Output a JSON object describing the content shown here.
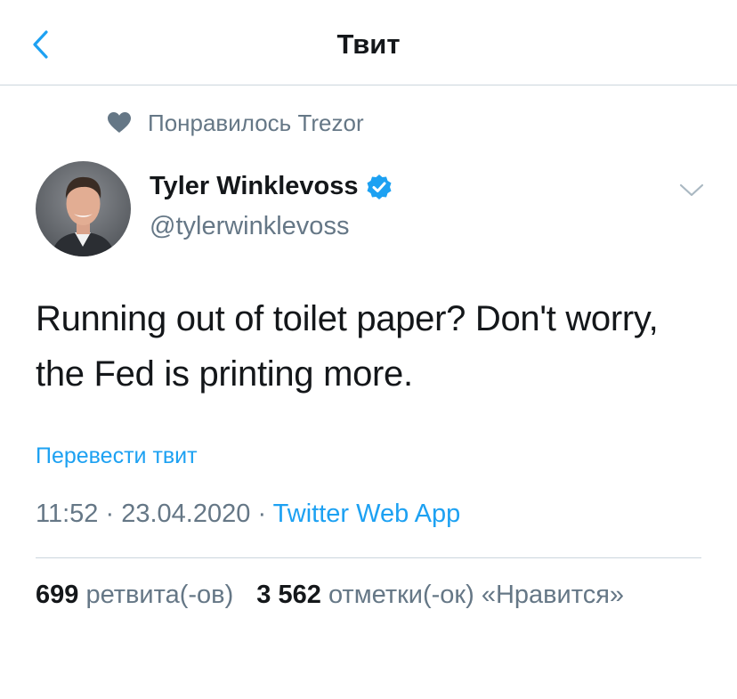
{
  "header": {
    "title": "Твит",
    "back_icon": "chevron-left-icon",
    "accent_color": "#1da1f2"
  },
  "social_context": {
    "icon": "heart-icon",
    "text": "Понравилось Trezor"
  },
  "author": {
    "name": "Tyler Winklevoss",
    "handle": "@tylerwinklevoss",
    "verified": true,
    "verified_icon": "verified-badge-icon"
  },
  "tweet": {
    "text": "Running out of toilet paper? Don't worry, the Fed is printing more.",
    "translate_label": "Перевести твит",
    "time": "11:52",
    "date": "23.04.2020",
    "separator": "·",
    "source": "Twitter Web App"
  },
  "stats": {
    "retweets_count": "699",
    "retweets_label": "ретвита(-ов)",
    "likes_count": "3 562",
    "likes_label": "отметки(-ок) «Нравится»"
  },
  "colors": {
    "primary_text": "#14171a",
    "secondary_text": "#657786",
    "link": "#1da1f2",
    "divider": "#ccd6dd",
    "verified_badge": "#1da1f2"
  }
}
